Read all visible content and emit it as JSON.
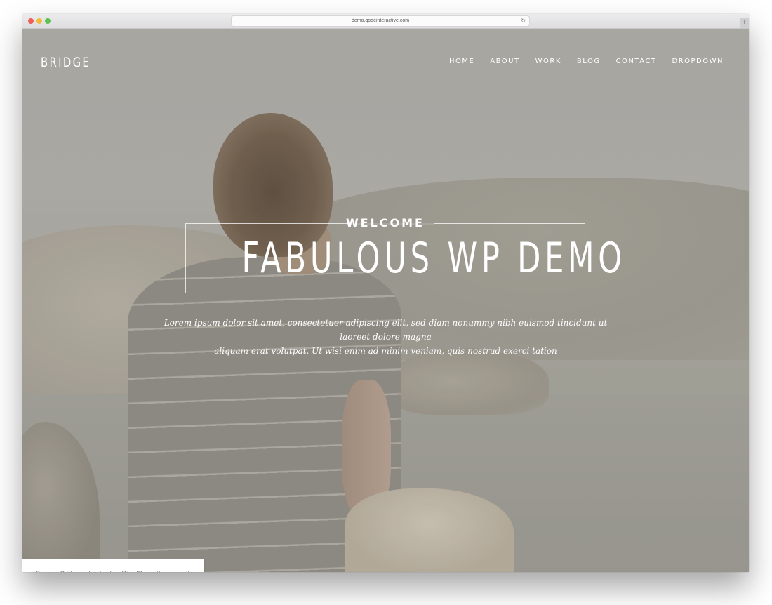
{
  "browser": {
    "url": "demo.qodeinteractive.com",
    "reload_icon": "↻",
    "new_tab_icon": "+"
  },
  "site": {
    "logo": "BRIDGE",
    "nav": [
      "HOME",
      "ABOUT",
      "WORK",
      "BLOG",
      "CONTACT",
      "DROPDOWN"
    ]
  },
  "hero": {
    "kicker": "WELCOME",
    "title": "FABULOUS WP DEMO",
    "text_line1": "Lorem ipsum dolor sit amet, consectetuer adipiscing elit, sed diam nonummy nibh euismod tincidunt ut laoreet dolore magna",
    "text_line2": "aliquam erat volutpat. Ut wisi enim ad minim veniam, quis nostrud exerci tation"
  },
  "promo": {
    "text": "Explore Bridge, a bestselling WordPress theme",
    "arrow_icon": "↑"
  }
}
